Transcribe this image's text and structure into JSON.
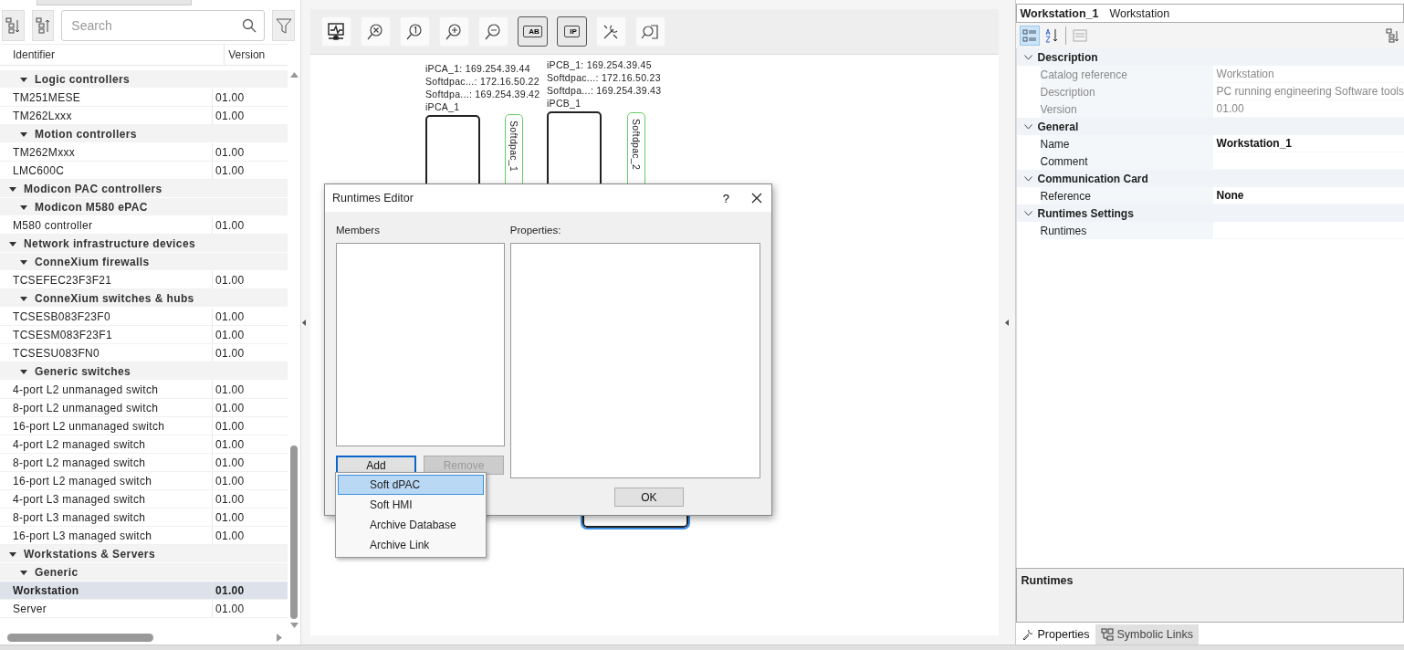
{
  "catalog": {
    "search": {
      "placeholder": "Search"
    },
    "columns": [
      "Identifier",
      "Version"
    ],
    "tree": [
      {
        "children": [
          {
            "label": "Logic controllers",
            "expanded": true,
            "children": [
              {
                "name": "TM251MESE",
                "version": "01.00",
                "selected": false
              },
              {
                "name": "TM262Lxxx",
                "version": "01.00",
                "selected": false
              }
            ]
          },
          {
            "label": "Motion controllers",
            "expanded": true,
            "children": [
              {
                "name": "TM262Mxxx",
                "version": "01.00",
                "selected": false
              },
              {
                "name": "LMC600C",
                "version": "01.00",
                "selected": false
              }
            ]
          }
        ]
      },
      {
        "label": "Modicon PAC controllers",
        "expanded": true,
        "children": [
          {
            "label": "Modicon M580 ePAC",
            "expanded": true,
            "children": [
              {
                "name": "M580 controller",
                "version": "01.00",
                "selected": false
              }
            ]
          }
        ]
      },
      {
        "label": "Network infrastructure devices",
        "expanded": true,
        "children": [
          {
            "label": "ConneXium firewalls",
            "expanded": true,
            "children": [
              {
                "name": "TCSEFEC23F3F21",
                "version": "01.00",
                "selected": false
              }
            ]
          },
          {
            "label": "ConneXium switches & hubs",
            "expanded": true,
            "children": [
              {
                "name": "TCSESB083F23F0",
                "version": "01.00",
                "selected": false
              },
              {
                "name": "TCSESM083F23F1",
                "version": "01.00",
                "selected": false
              },
              {
                "name": "TCSESU083FN0",
                "version": "01.00",
                "selected": false
              }
            ]
          },
          {
            "label": "Generic switches",
            "expanded": true,
            "children": [
              {
                "name": "4-port L2 unmanaged switch",
                "version": "01.00",
                "selected": false
              },
              {
                "name": "8-port L2 unmanaged switch",
                "version": "01.00",
                "selected": false
              },
              {
                "name": "16-port L2 unmanaged switch",
                "version": "01.00",
                "selected": false
              },
              {
                "name": "4-port L2 managed switch",
                "version": "01.00",
                "selected": false
              },
              {
                "name": "8-port L2 managed switch",
                "version": "01.00",
                "selected": false
              },
              {
                "name": "16-port L2 managed switch",
                "version": "01.00",
                "selected": false
              },
              {
                "name": "4-port L3 managed switch",
                "version": "01.00",
                "selected": false
              },
              {
                "name": "8-port L3 managed switch",
                "version": "01.00",
                "selected": false
              },
              {
                "name": "16-port L3 managed switch",
                "version": "01.00",
                "selected": false
              }
            ]
          }
        ]
      },
      {
        "label": "Workstations & Servers",
        "expanded": true,
        "children": [
          {
            "label": "Generic",
            "expanded": true,
            "children": [
              {
                "name": "Workstation",
                "version": "01.00",
                "selected": true
              },
              {
                "name": "Server",
                "version": "01.00",
                "selected": false
              }
            ]
          }
        ]
      }
    ]
  },
  "canvas": {
    "toolbar": [
      {
        "kind": "monitor",
        "on": false
      },
      {
        "kind": "zoom-fit",
        "on": false
      },
      {
        "kind": "zoom-one",
        "on": false
      },
      {
        "kind": "zoom-in",
        "on": false
      },
      {
        "kind": "zoom-out",
        "on": false
      },
      {
        "kind": "tag",
        "text": "AB",
        "on": true
      },
      {
        "kind": "tag",
        "text": "IP",
        "on": true
      },
      {
        "kind": "tools",
        "on": false
      },
      {
        "kind": "find",
        "on": false
      }
    ],
    "devices": [
      {
        "labels": [
          "iPCA_1: 169.254.39.44",
          "Softdpac...: 172.16.50.22",
          "Softdpa...: 169.254.39.42",
          "iPCA_1"
        ],
        "runtime": "Softdpac_1"
      },
      {
        "labels": [
          "iPCB_1: 169.254.39.45",
          "Softdpac...: 172.16.50.23",
          "Softdpa...: 169.254.39.43",
          "iPCB_1"
        ],
        "runtime": "Softdpac_2"
      }
    ]
  },
  "dialog": {
    "title": "Runtimes Editor",
    "help": "?",
    "members_label": "Members",
    "properties_label": "Properties:",
    "buttons": [
      {
        "label": "Add",
        "focused": true,
        "disabled": false
      },
      {
        "label": "Remove",
        "focused": false,
        "disabled": true
      }
    ],
    "ok": "OK",
    "menu": [
      {
        "label": "Soft dPAC",
        "selected": true
      },
      {
        "label": "Soft HMI",
        "selected": false
      },
      {
        "label": "Archive Database",
        "selected": false
      },
      {
        "label": "Archive Link",
        "selected": false
      }
    ]
  },
  "properties": {
    "header": {
      "name": "Workstation_1",
      "type": "Workstation"
    },
    "toolbar": [
      {
        "kind": "categorized",
        "selected": true
      },
      {
        "kind": "alphabetical",
        "selected": false
      },
      {
        "kind": "pages",
        "selected": false
      }
    ],
    "sections": [
      {
        "title": "Description",
        "expanded": true,
        "rows": [
          {
            "label": "Catalog reference",
            "value": "Workstation",
            "readonly": true,
            "bold": false
          },
          {
            "label": "Description",
            "value": "PC running engineering Software tools",
            "readonly": true,
            "bold": false
          },
          {
            "label": "Version",
            "value": "01.00",
            "readonly": true,
            "bold": false
          }
        ]
      },
      {
        "title": "General",
        "expanded": true,
        "rows": [
          {
            "label": "Name",
            "value": "Workstation_1",
            "readonly": false,
            "bold": true
          },
          {
            "label": "Comment",
            "readonly": false,
            "bold": false
          }
        ]
      },
      {
        "title": "Communication Card",
        "expanded": true,
        "rows": [
          {
            "label": "Reference",
            "value": "None",
            "readonly": false,
            "bold": true
          }
        ]
      },
      {
        "title": "Runtimes Settings",
        "expanded": true,
        "rows": [
          {
            "label": "Runtimes",
            "readonly": false,
            "bold": false
          }
        ]
      }
    ],
    "description_title": "Runtimes",
    "tabs": [
      {
        "kind": "wrench",
        "label": "Properties",
        "selected": true
      },
      {
        "kind": "links",
        "label": "Symbolic Links",
        "selected": false
      }
    ]
  }
}
